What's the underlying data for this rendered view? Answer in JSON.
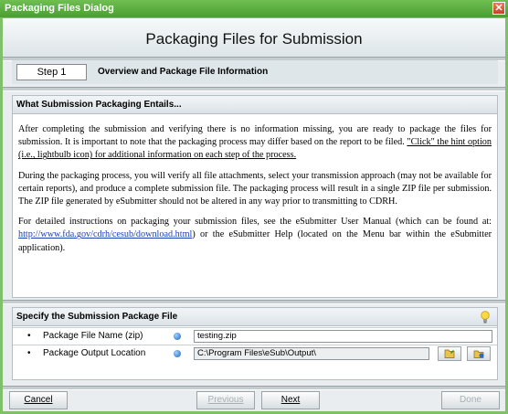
{
  "window": {
    "title": "Packaging Files Dialog",
    "close_glyph": "✕"
  },
  "header": {
    "title": "Packaging Files for Submission"
  },
  "step": {
    "number_label": "Step 1",
    "title": "Overview and Package File Information"
  },
  "overview": {
    "heading": "What Submission Packaging Entails...",
    "p1_text": "After completing the submission and verifying there is no information missing, you are ready to package the files for submission. It is important to note that the packaging process may differ based on the report to be filed. ",
    "p1_hint": "\"Click\" the hint option (i.e., lightbulb icon) for additional information on each step of the process.",
    "p2": "During the packaging process, you will verify all file attachments, select your transmission approach (may not be available for certain reports), and produce a complete submission file. The packaging process will result in a single ZIP file per submission. The ZIP file generated by eSubmitter should not be altered in any way prior to transmitting to CDRH.",
    "p3_before": "For detailed instructions on packaging your submission files, see the eSubmitter User Manual (which can be found at: ",
    "p3_link": "http://www.fda.gov/cdrh/cesub/download.html",
    "p3_after": ") or the eSubmitter Help (located on the Menu bar within the eSubmitter application)."
  },
  "package": {
    "heading": "Specify the Submission Package File",
    "bullet_glyph": "•",
    "file_name_label": "Package File Name (zip)",
    "file_name_value": "testing.zip",
    "output_location_label": "Package Output Location",
    "output_location_value": "C:\\Program Files\\eSub\\Output\\"
  },
  "footer": {
    "cancel": "Cancel",
    "previous": "Previous",
    "next": "Next",
    "done": "Done"
  },
  "icons": {
    "hint": "lightbulb-icon",
    "browse": "folder-icon",
    "open_output": "open-folder-icon"
  }
}
